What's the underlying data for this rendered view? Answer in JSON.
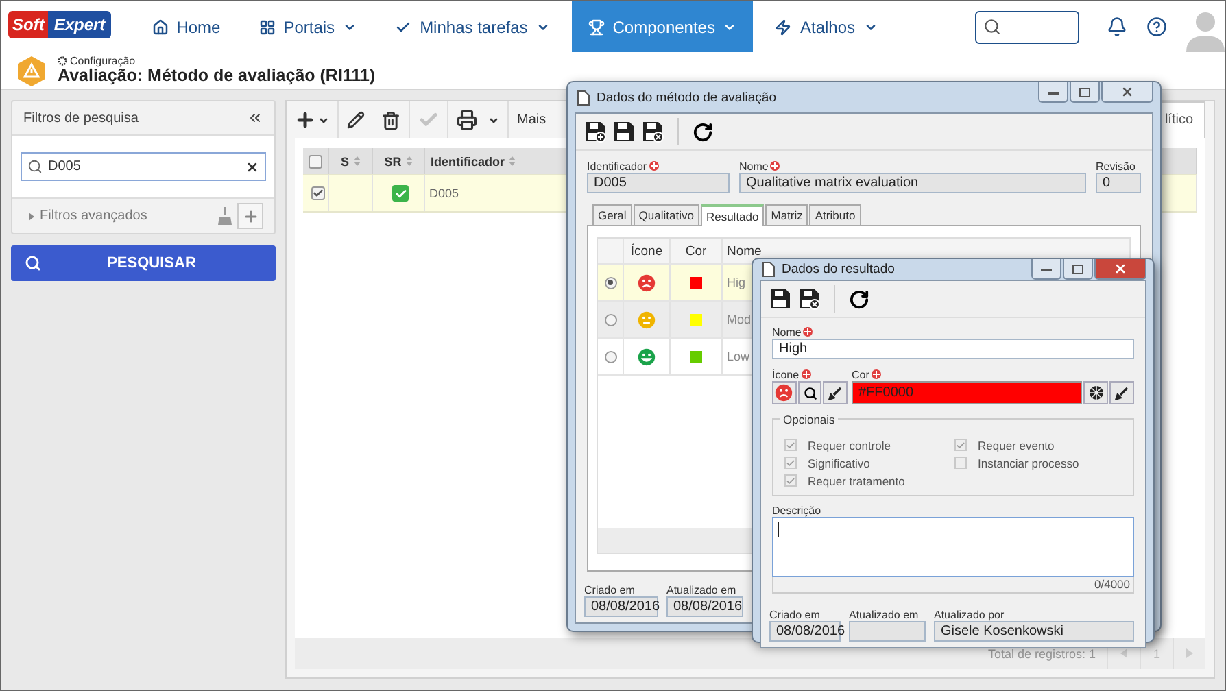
{
  "logo": {
    "part_1": "Soft",
    "part_2": "Expert"
  },
  "nav": [
    {
      "label": "Home",
      "dropdown": false,
      "selected": false
    },
    {
      "label": "Portais",
      "dropdown": true,
      "selected": false
    },
    {
      "label": "Minhas tarefas",
      "dropdown": true,
      "selected": false
    },
    {
      "label": "Componentes",
      "dropdown": true,
      "selected": true
    },
    {
      "label": "Atalhos",
      "dropdown": true,
      "selected": false
    }
  ],
  "header": {
    "breadcrumb": "Configuração",
    "title": "Avaliação: Método de avaliação (RI111)"
  },
  "filters": {
    "title": "Filtros de pesquisa",
    "search_value": "D005",
    "advanced": "Filtros avançados",
    "search_button": "PESQUISAR"
  },
  "toolbar": {
    "more": "Mais"
  },
  "main_tab": "lítico",
  "grid": {
    "all_checked": false,
    "columns": [
      "S",
      "SR",
      "Identificador"
    ],
    "rows": [
      {
        "checked": true,
        "sr": true,
        "identificador": "D005"
      }
    ]
  },
  "footer": {
    "total": "Total de registros: 1",
    "page": "1"
  },
  "method_dialog": {
    "title": "Dados do método de avaliação",
    "fields": [
      {
        "label": "Identificador",
        "value": "D005",
        "required": true
      },
      {
        "label": "Nome",
        "value": "Qualitative matrix evaluation",
        "required": true
      },
      {
        "label": "Revisão",
        "value": "0",
        "required": false
      }
    ],
    "tabs": [
      {
        "label": "Geral",
        "selected": false
      },
      {
        "label": "Qualitativo",
        "selected": false
      },
      {
        "label": "Resultado",
        "selected": true
      },
      {
        "label": "Matriz",
        "selected": false
      },
      {
        "label": "Atributo",
        "selected": false
      }
    ],
    "columns": [
      "Ícone",
      "Cor",
      "Nome"
    ],
    "rows": [
      {
        "selected": true,
        "kind": "sad",
        "color": "#ff0000",
        "name": "Hig"
      },
      {
        "selected": false,
        "kind": "neutral",
        "color": "#ffff00",
        "name": "Mod"
      },
      {
        "selected": false,
        "kind": "happy",
        "color": "#66cc00",
        "name": "Low"
      }
    ],
    "footer": [
      {
        "label": "Criado em",
        "value": "08/08/2016"
      },
      {
        "label": "Atualizado em",
        "value": "08/08/2016"
      }
    ]
  },
  "result_dialog": {
    "title": "Dados do resultado",
    "name": {
      "label": "Nome",
      "value": "High",
      "required": true
    },
    "icon_label": "Ícone",
    "icon_required": true,
    "color": {
      "label": "Cor",
      "value": "#FF0000",
      "required": true,
      "color": "#ff0000"
    },
    "options_title": "Opcionais",
    "options": [
      {
        "label": "Requer controle",
        "checked": true
      },
      {
        "label": "Significativo",
        "checked": true
      },
      {
        "label": "Requer tratamento",
        "checked": true
      },
      {
        "label": "Requer evento",
        "checked": true
      },
      {
        "label": "Instanciar processo",
        "checked": false
      }
    ],
    "description": {
      "label": "Descrição",
      "counter": "0/4000"
    },
    "footer": [
      {
        "label": "Criado em",
        "value": "08/08/2016"
      },
      {
        "label": "Atualizado em"
      },
      {
        "label": "Atualizado por",
        "value": "Gisele Kosenkowski"
      }
    ]
  }
}
